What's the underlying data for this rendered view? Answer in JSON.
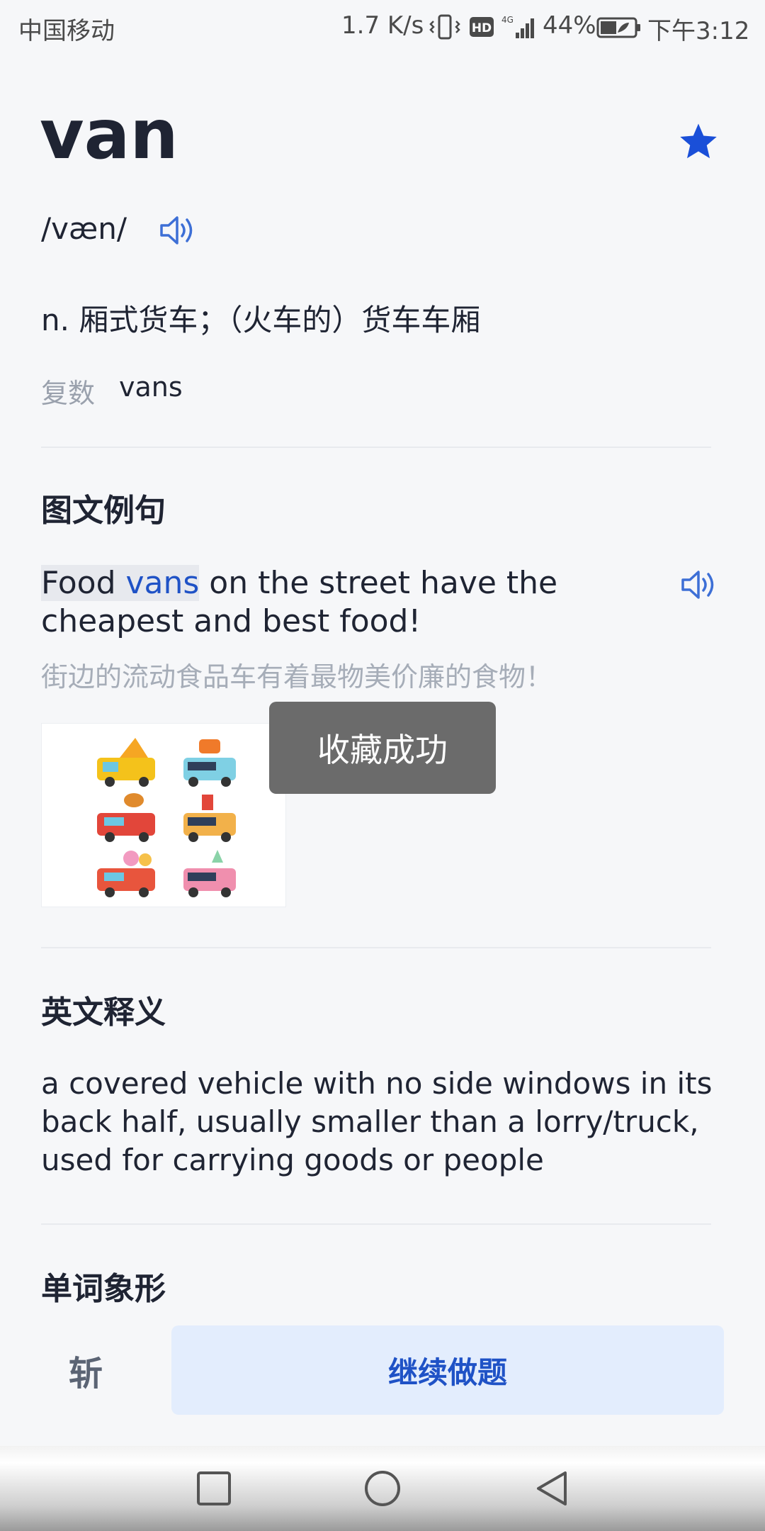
{
  "status_bar": {
    "carrier": "中国移动",
    "net_speed": "1.7 K/s",
    "hd_badge": "HD",
    "network_type": "4G",
    "battery_percent": "44%",
    "time": "下午3:12"
  },
  "word": {
    "title": "van",
    "phonetic": "/væn/",
    "definition_cn": "n. 厢式货车；（火车的）货车车厢",
    "plural_label": "复数",
    "plural_value": "vans",
    "favorited": true
  },
  "sections": {
    "example_title": "图文例句",
    "english_def_title": "英文释义",
    "word_image_title": "单词象形"
  },
  "example": {
    "en_highlight_plain": "Food ",
    "en_highlight_word": "vans",
    "en_rest": " on the street have the cheapest and best food!",
    "cn": "街边的流动食品车有着最物美价廉的食物！"
  },
  "toast": {
    "text": "收藏成功"
  },
  "english_definition": "a covered vehicle with no side windows in its back half, usually smaller than a lorry/truck, used for carrying goods or people",
  "bottom_bar": {
    "skip_label": "斩",
    "continue_label": "继续做题"
  },
  "colors": {
    "accent": "#1f52c6",
    "star": "#1a4fd8",
    "muted_text": "#9aa1ad"
  },
  "icons": {
    "favorite": "star-icon",
    "pronounce": "speaker-icon",
    "nav_recent": "square-icon",
    "nav_home": "circle-icon",
    "nav_back": "triangle-back-icon"
  }
}
